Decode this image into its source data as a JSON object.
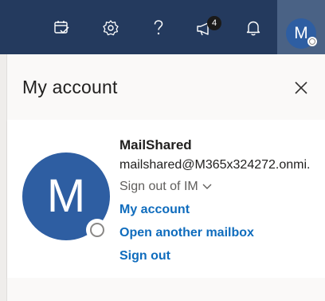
{
  "topbar": {
    "icons": [
      "my-day-icon",
      "settings-icon",
      "help-icon",
      "feedback-icon",
      "notifications-icon"
    ],
    "notification_count": "4",
    "avatar_initial": "M"
  },
  "panel": {
    "title": "My account",
    "close_icon": "close-icon"
  },
  "account": {
    "avatar_initial": "M",
    "name": "MailShared",
    "email": "mailshared@M365x324272.onmi.",
    "sign_out_im_label": "Sign out of IM",
    "links": {
      "my_account": "My account",
      "open_mailbox": "Open another mailbox",
      "sign_out": "Sign out"
    }
  },
  "colors": {
    "topbar": "#243a5e",
    "avatar": "#2e5ea2",
    "link": "#0f6cbd"
  }
}
